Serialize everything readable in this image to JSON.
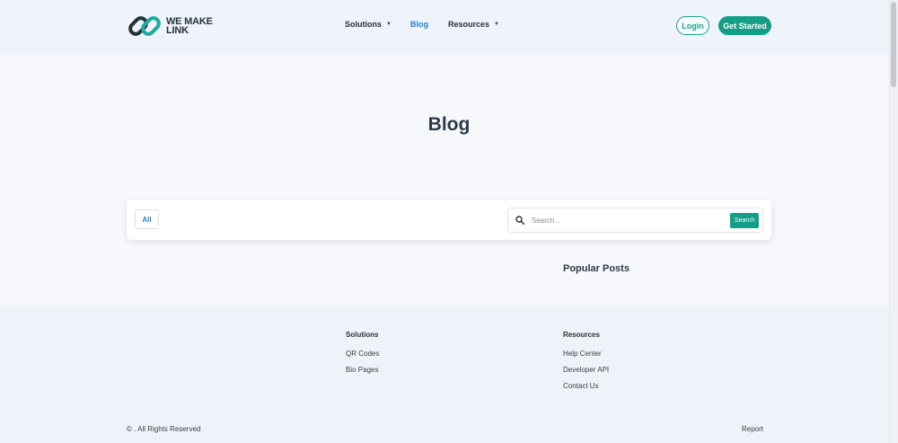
{
  "header": {
    "logo_text_line1": "WE MAKE",
    "logo_text_line2": "LINK",
    "nav": {
      "solutions": "Solutions",
      "blog": "Blog",
      "resources": "Resources"
    },
    "login_label": "Login",
    "get_started_label": "Get Started"
  },
  "main": {
    "title": "Blog",
    "filter_all": "All",
    "search": {
      "placeholder": "Search...",
      "button_label": "Search"
    },
    "popular_posts_title": "Popular Posts"
  },
  "footer": {
    "solutions": {
      "heading": "Solutions",
      "links": [
        "QR Codes",
        "Bio Pages"
      ]
    },
    "resources": {
      "heading": "Resources",
      "links": [
        "Help Center",
        "Developer API",
        "Contact Us"
      ]
    },
    "copyright": "©  . All Rights Reserved",
    "report": "Report"
  },
  "colors": {
    "brand_green": "#159e87",
    "link_blue": "#1f86c6",
    "header_bg": "#eef3fc",
    "page_bg": "#f6f8fc"
  },
  "icons": {
    "logo": "chain-link-icon",
    "search": "search-icon",
    "dropdown": "caret-down-icon"
  }
}
